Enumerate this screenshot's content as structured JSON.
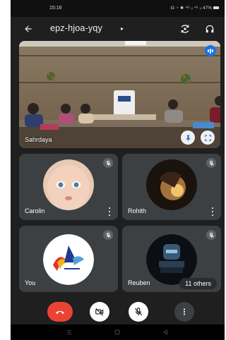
{
  "status_bar": {
    "time": "15:16",
    "icons_text": "☊ ◔ ✱ ⁴ᴳ ᵢₗ ⁴⁶ ᵢₗ 47%"
  },
  "app_bar": {
    "meeting_code": "epz-hjoa-yqy",
    "chevron": "▸"
  },
  "main_video": {
    "participant_name": "Sahrdaya"
  },
  "tiles": [
    {
      "name": "Carolin"
    },
    {
      "name": "Rohith"
    },
    {
      "name": "You"
    },
    {
      "name": "Reuben",
      "badge": "11 others"
    }
  ],
  "colors": {
    "end_call": "#ea4335",
    "speaking_indicator": "#1a73e8",
    "tile_bg": "#3c4043",
    "screen_bg": "#1f1f1f"
  }
}
